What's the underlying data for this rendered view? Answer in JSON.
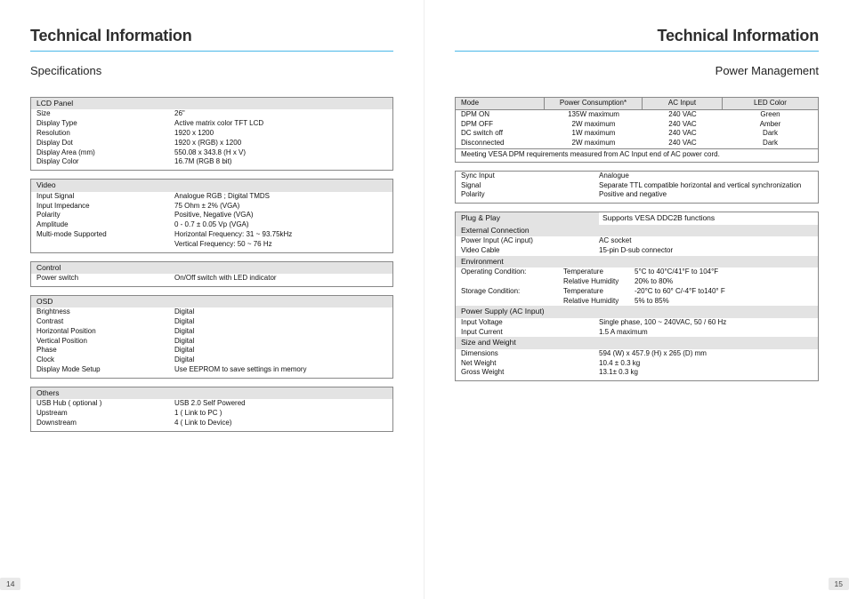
{
  "left": {
    "title": "Technical Information",
    "subtitle": "Specifications",
    "pagenum": "14",
    "sections": {
      "lcdpanel": {
        "head": "LCD Panel",
        "rows": {
          "size_l": "Size",
          "size_v": "26\"",
          "disptype_l": "Display Type",
          "disptype_v": "Active matrix color TFT LCD",
          "res_l": "Resolution",
          "res_v": "1920 x 1200",
          "dot_l": "Display Dot",
          "dot_v": "1920 x (RGB) x 1200",
          "area_l": "Display Area (mm)",
          "area_v": "550.08 x 343.8 (H x V)",
          "color_l": "Display Color",
          "color_v": "16.7M (RGB 8 bit)"
        }
      },
      "video": {
        "head": "Video",
        "rows": {
          "insig_l": "Input Signal",
          "insig_v": "Analogue RGB ; Digital TMDS",
          "imp_l": "Input Impedance",
          "imp_v": "75 Ohm ± 2% (VGA)",
          "pol_l": "Polarity",
          "pol_v": "Positive, Negative (VGA)",
          "amp_l": "Amplitude",
          "amp_v": "0 - 0.7 ± 0.05 Vp (VGA)",
          "mm_l": "Multi-mode Supported",
          "mm_v1": "Horizontal Frequency: 31 ~ 93.75kHz",
          "mm_v2": "Vertical Frequency: 50 ~ 76 Hz"
        }
      },
      "control": {
        "head": "Control",
        "rows": {
          "pw_l": "Power switch",
          "pw_v": "On/Off switch with LED indicator"
        }
      },
      "osd": {
        "head": "OSD",
        "rows": {
          "br_l": "Brightness",
          "br_v": "Digital",
          "co_l": "Contrast",
          "co_v": "Digital",
          "hp_l": "Horizontal Position",
          "hp_v": "Digital",
          "vp_l": "Vertical Position",
          "vp_v": "Digital",
          "ph_l": "Phase",
          "ph_v": "Digital",
          "cl_l": "Clock",
          "cl_v": "Digital",
          "dm_l": "Display Mode Setup",
          "dm_v": "Use EEPROM to save settings in memory"
        }
      },
      "others": {
        "head": "Others",
        "rows": {
          "hub_l": "USB Hub ( optional )",
          "hub_v": "USB 2.0 Self Powered",
          "up_l": "Upstream",
          "up_v": "1 ( Link to PC )",
          "dn_l": "Downstream",
          "dn_v": "4 ( Link to Device)"
        }
      }
    }
  },
  "right": {
    "title": "Technical Information",
    "subtitle": "Power Management",
    "pagenum": "15",
    "pm": {
      "head": {
        "a": "Mode",
        "b": "Power Consumption*",
        "c": "AC Input",
        "d": "LED Color"
      },
      "rows": {
        "r1a": "DPM ON",
        "r1b": "135W maximum",
        "r1c": "240 VAC",
        "r1d": "Green",
        "r2a": "DPM OFF",
        "r2b": "2W maximum",
        "r2c": "240 VAC",
        "r2d": "Amber",
        "r3a": "DC switch off",
        "r3b": "1W maximum",
        "r3c": "240 VAC",
        "r3d": "Dark",
        "r4a": "Disconnected",
        "r4b": "2W maximum",
        "r4c": "240 VAC",
        "r4d": "Dark"
      },
      "note": "Meeting VESA DPM requirements measured from AC Input end of AC power cord."
    },
    "sync": {
      "si_l": "Sync Input",
      "si_v": "Analogue",
      "sg_l": "Signal",
      "sg_v": "Separate TTL compatible horizontal and vertical synchronization",
      "po_l": "Polarity",
      "po_v": "Positive and negative"
    },
    "misc": {
      "pp_head": "Plug & Play",
      "pp_v": "Supports VESA DDC2B functions",
      "ec_head": "External Connection",
      "pi_l": "Power Input (AC input)",
      "pi_v": "AC socket",
      "vc_l": "Video Cable",
      "vc_v": "15-pin D-sub connector",
      "env_head": "Environment",
      "oc_l": "Operating Condition:",
      "oc_t_l": "Temperature",
      "oc_t_v": "5°C to 40°C/41°F to 104°F",
      "oc_r_l": "Relative Humidity",
      "oc_r_v": "20% to 80%",
      "sc_l": "Storage Condition:",
      "sc_t_l": "Temperature",
      "sc_t_v": "-20°C to 60° C/-4°F to140° F",
      "sc_r_l": "Relative Humidity",
      "sc_r_v": "5% to 85%",
      "ps_head": "Power Supply (AC Input)",
      "iv_l": "Input Voltage",
      "iv_v": "Single phase, 100 ~ 240VAC, 50 / 60 Hz",
      "ic_l": "Input Current",
      "ic_v": "1.5 A maximum",
      "sw_head": "Size and Weight",
      "di_l": "Dimensions",
      "di_v": "594 (W) x 457.9 (H) x 265 (D) mm",
      "nw_l": "Net Weight",
      "nw_v": "10.4 ± 0.3 kg",
      "gw_l": "Gross Weight",
      "gw_v": "13.1± 0.3 kg"
    }
  }
}
